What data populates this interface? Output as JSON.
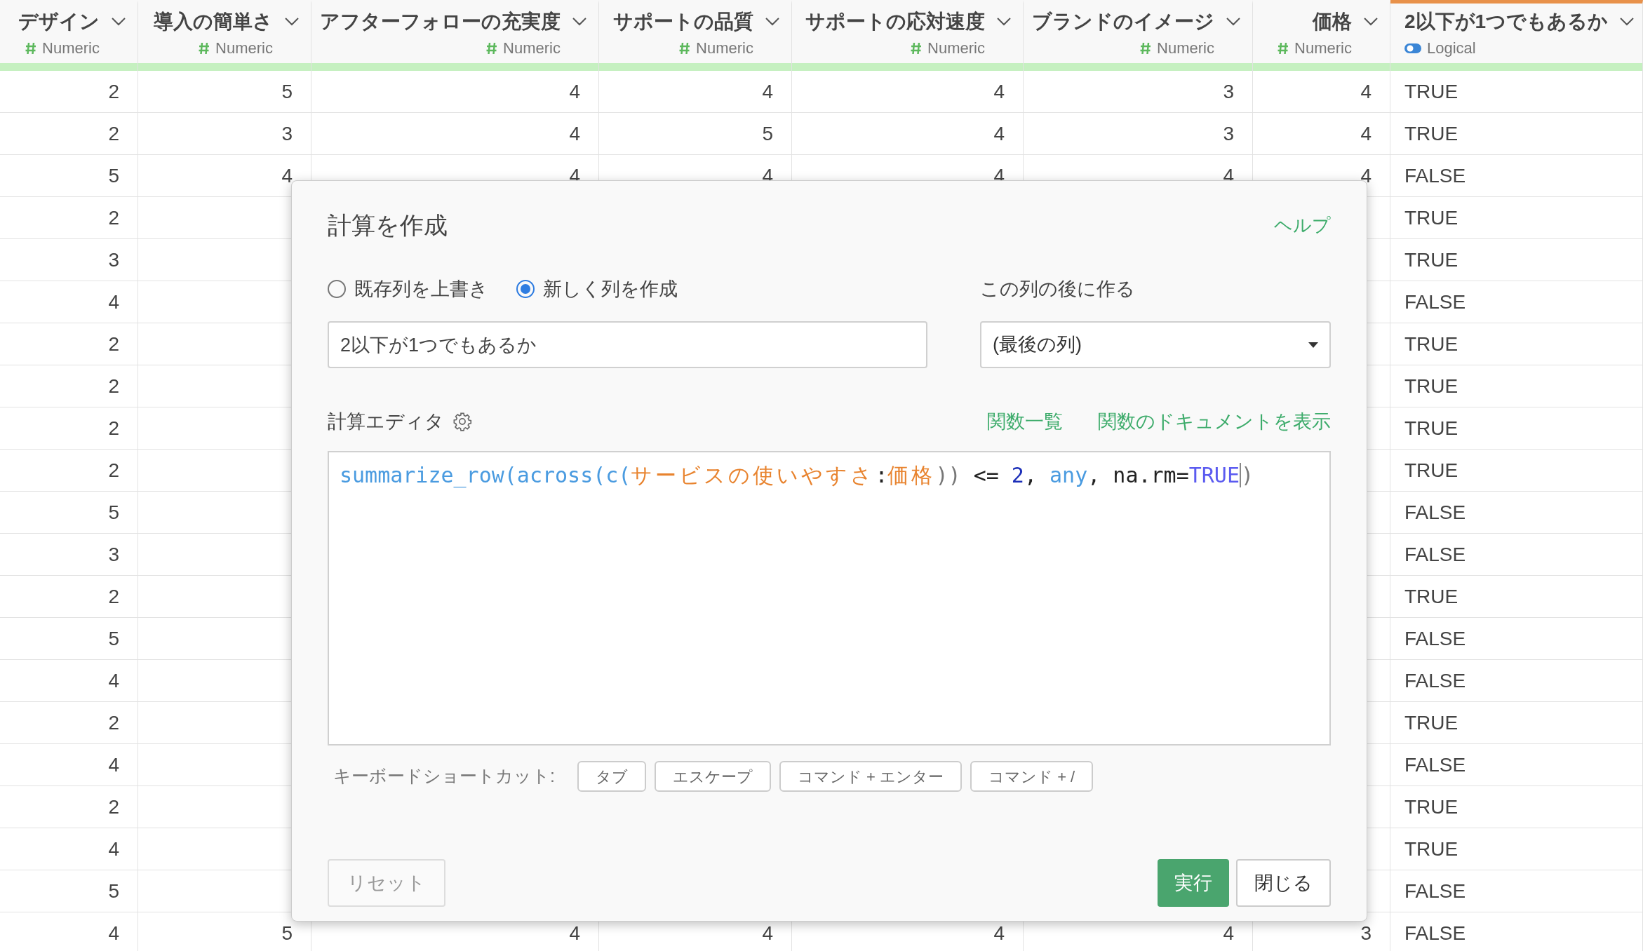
{
  "table": {
    "columns": [
      {
        "name": "デザイン",
        "type": "Numeric",
        "kind": "numeric",
        "selected": false
      },
      {
        "name": "導入の簡単さ",
        "type": "Numeric",
        "kind": "numeric",
        "selected": false
      },
      {
        "name": "アフターフォローの充実度",
        "type": "Numeric",
        "kind": "numeric",
        "selected": false
      },
      {
        "name": "サポートの品質",
        "type": "Numeric",
        "kind": "numeric",
        "selected": false
      },
      {
        "name": "サポートの応対速度",
        "type": "Numeric",
        "kind": "numeric",
        "selected": false
      },
      {
        "name": "ブランドのイメージ",
        "type": "Numeric",
        "kind": "numeric",
        "selected": false
      },
      {
        "name": "価格",
        "type": "Numeric",
        "kind": "numeric",
        "selected": false
      },
      {
        "name": "2以下が1つでもあるか",
        "type": "Logical",
        "kind": "logical",
        "selected": true
      }
    ],
    "rows": [
      [
        "2",
        "5",
        "4",
        "4",
        "4",
        "3",
        "4",
        "TRUE"
      ],
      [
        "2",
        "3",
        "4",
        "5",
        "4",
        "3",
        "4",
        "TRUE"
      ],
      [
        "5",
        "4",
        "4",
        "4",
        "4",
        "4",
        "4",
        "FALSE"
      ],
      [
        "2",
        null,
        null,
        null,
        null,
        null,
        null,
        "TRUE"
      ],
      [
        "3",
        null,
        null,
        null,
        null,
        null,
        null,
        "TRUE"
      ],
      [
        "4",
        null,
        null,
        null,
        null,
        null,
        null,
        "FALSE"
      ],
      [
        "2",
        null,
        null,
        null,
        null,
        null,
        null,
        "TRUE"
      ],
      [
        "2",
        null,
        null,
        null,
        null,
        null,
        null,
        "TRUE"
      ],
      [
        "2",
        null,
        null,
        null,
        null,
        null,
        null,
        "TRUE"
      ],
      [
        "2",
        null,
        null,
        null,
        null,
        null,
        null,
        "TRUE"
      ],
      [
        "5",
        null,
        null,
        null,
        null,
        null,
        null,
        "FALSE"
      ],
      [
        "3",
        null,
        null,
        null,
        null,
        null,
        null,
        "FALSE"
      ],
      [
        "2",
        null,
        null,
        null,
        null,
        null,
        null,
        "TRUE"
      ],
      [
        "5",
        null,
        null,
        null,
        null,
        null,
        null,
        "FALSE"
      ],
      [
        "4",
        null,
        null,
        null,
        null,
        null,
        null,
        "FALSE"
      ],
      [
        "2",
        null,
        null,
        null,
        null,
        null,
        null,
        "TRUE"
      ],
      [
        "4",
        null,
        null,
        null,
        null,
        null,
        null,
        "FALSE"
      ],
      [
        "2",
        null,
        null,
        null,
        null,
        null,
        null,
        "TRUE"
      ],
      [
        "4",
        null,
        null,
        null,
        null,
        null,
        null,
        "TRUE"
      ],
      [
        "5",
        null,
        null,
        null,
        null,
        null,
        null,
        "FALSE"
      ],
      [
        "4",
        "5",
        "4",
        "4",
        "4",
        "4",
        "3",
        "FALSE"
      ]
    ]
  },
  "dialog": {
    "title": "計算を作成",
    "help": "ヘルプ",
    "modes": [
      {
        "label": "既存列を上書き",
        "selected": false
      },
      {
        "label": "新しく列を作成",
        "selected": true
      }
    ],
    "name_value": "2以下が1つでもあるか",
    "position_label": "この列の後に作る",
    "position_value": "(最後の列)",
    "editor_label": "計算エディタ",
    "links": [
      "関数一覧",
      "関数のドキュメントを表示"
    ],
    "code": [
      {
        "text": "summarize_row(across(c(",
        "kind": "function"
      },
      {
        "text": "サービスの使いやすさ",
        "kind": "column"
      },
      {
        "text": ":",
        "kind": "plain"
      },
      {
        "text": "価格",
        "kind": "column"
      },
      {
        "text": ")) ",
        "kind": "paren"
      },
      {
        "text": "<= ",
        "kind": "plain"
      },
      {
        "text": "2",
        "kind": "number"
      },
      {
        "text": ", ",
        "kind": "plain"
      },
      {
        "text": "any",
        "kind": "function"
      },
      {
        "text": ", na.rm=",
        "kind": "plain"
      },
      {
        "text": "TRUE",
        "kind": "constant"
      },
      {
        "text": ")",
        "kind": "paren"
      }
    ],
    "shortcuts_label": "キーボードショートカット:",
    "shortcuts": [
      "タブ",
      "エスケープ",
      "コマンド + エンター",
      "コマンド + /"
    ],
    "reset": "リセット",
    "run": "実行",
    "close": "閉じる"
  }
}
